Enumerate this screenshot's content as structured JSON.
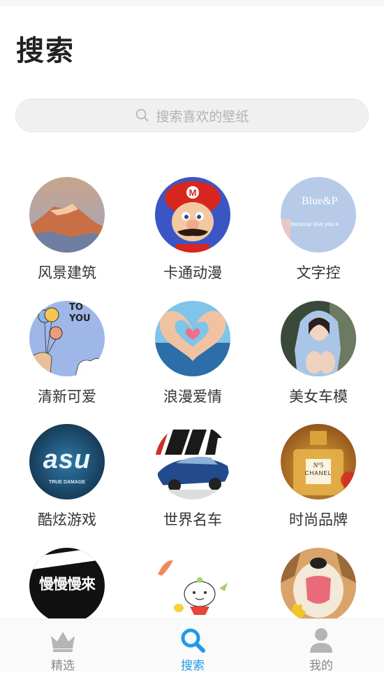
{
  "header": {
    "title": "搜索"
  },
  "search": {
    "placeholder": "搜索喜欢的壁纸",
    "icon": "search-icon"
  },
  "categories": [
    {
      "label": "风景建筑"
    },
    {
      "label": "卡通动漫"
    },
    {
      "label": "文字控",
      "thumb_text_1": "Blue&P",
      "thumb_text_2": "because love you e"
    },
    {
      "label": "清新可爱",
      "thumb_text_1": "TO",
      "thumb_text_2": "YOU"
    },
    {
      "label": "浪漫爱情"
    },
    {
      "label": "美女车模"
    },
    {
      "label": "酷炫游戏",
      "thumb_text_1": "asu",
      "thumb_text_2": "TRUE DAMAGE"
    },
    {
      "label": "世界名车"
    },
    {
      "label": "时尚品牌",
      "thumb_text_1": "N°5",
      "thumb_text_2": "CHANEL"
    },
    {
      "label": "",
      "thumb_text_1": "慢慢慢來"
    },
    {
      "label": ""
    },
    {
      "label": ""
    }
  ],
  "tabbar": {
    "tabs": [
      {
        "label": "精选",
        "icon": "crown-icon"
      },
      {
        "label": "搜索",
        "icon": "search-icon",
        "active": true
      },
      {
        "label": "我的",
        "icon": "person-icon"
      }
    ],
    "active_color": "#1e9be8",
    "inactive_color": "#888888"
  }
}
